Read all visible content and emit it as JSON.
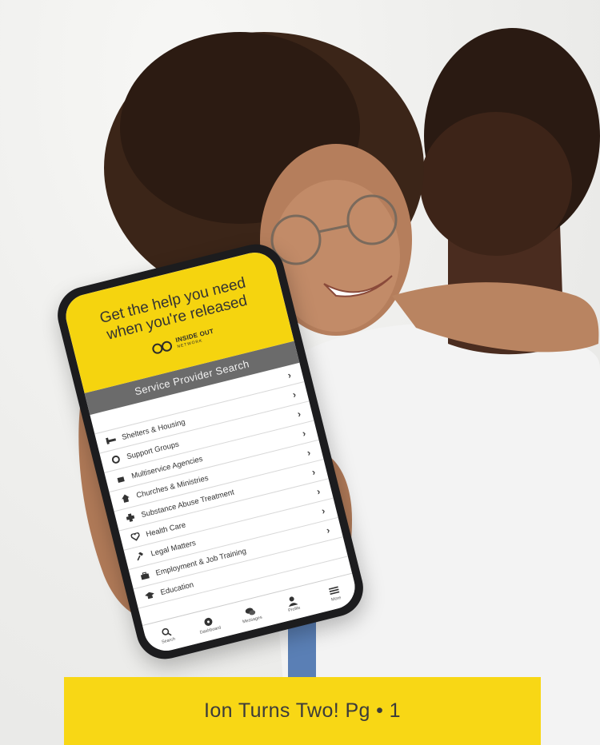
{
  "photo": {
    "description_icon": "couple-hugging-photo"
  },
  "phone": {
    "hero_title": "Get the help you need when you're released",
    "logo": {
      "name": "INSIDE OUT",
      "tagline": "NETWORK"
    },
    "search_title": "Service Provider Search",
    "items": [
      {
        "label": "",
        "icon": "none"
      },
      {
        "label": "Shelters & Housing",
        "icon": "bed-icon"
      },
      {
        "label": "Support Groups",
        "icon": "lifebuoy-icon"
      },
      {
        "label": "Multiservice Agencies",
        "icon": "agency-icon"
      },
      {
        "label": "Churches & Ministries",
        "icon": "church-icon"
      },
      {
        "label": "Substance Abuse Treatment",
        "icon": "treatment-icon"
      },
      {
        "label": "Health Care",
        "icon": "heart-icon"
      },
      {
        "label": "Legal Matters",
        "icon": "gavel-icon"
      },
      {
        "label": "Employment & Job Training",
        "icon": "briefcase-icon"
      },
      {
        "label": "Education",
        "icon": "graduation-cap-icon"
      }
    ],
    "tabs": [
      {
        "label": "Search",
        "icon": "search-icon"
      },
      {
        "label": "Dashboard",
        "icon": "dashboard-icon"
      },
      {
        "label": "Messages",
        "icon": "messages-icon"
      },
      {
        "label": "Profile",
        "icon": "profile-icon"
      },
      {
        "label": "More",
        "icon": "menu-icon"
      }
    ]
  },
  "caption": {
    "text": "Ion Turns Two! Pg • 1"
  },
  "colors": {
    "brand_yellow": "#f5d40f",
    "bar_gray": "#6b6b6b"
  }
}
